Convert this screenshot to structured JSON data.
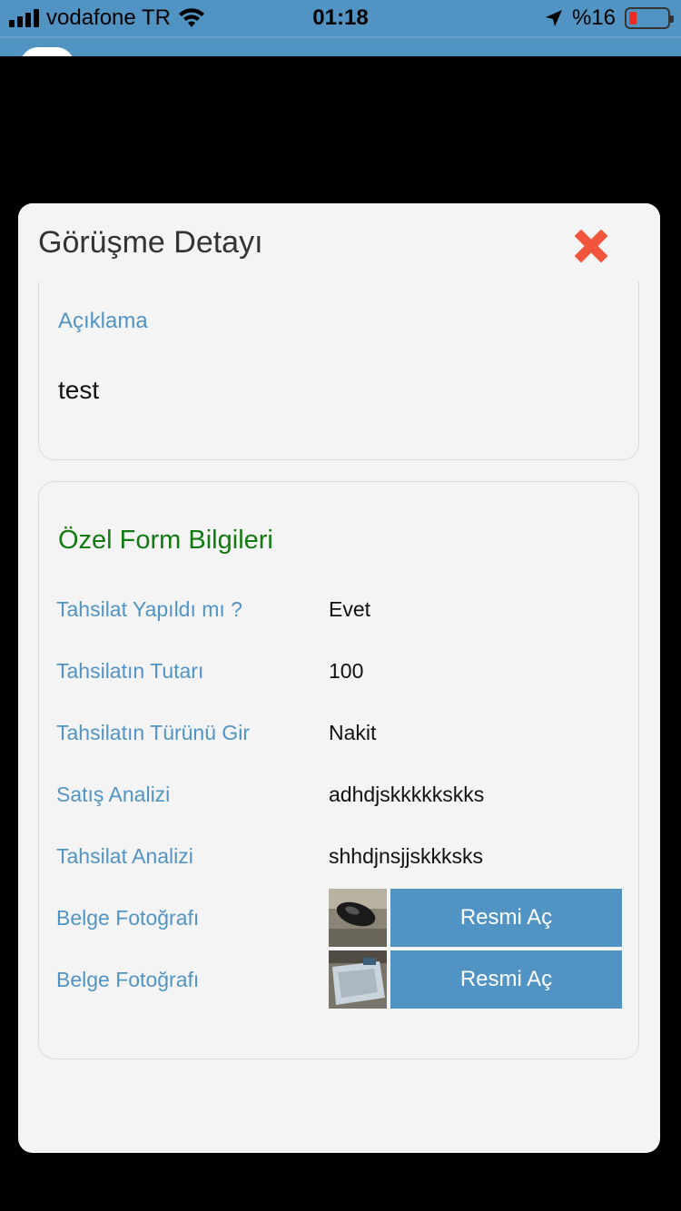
{
  "status_bar": {
    "carrier": "vodafone TR",
    "time": "01:18",
    "battery_percent": "%16",
    "battery_level": 0.16,
    "icons": [
      "signal-icon",
      "wifi-icon",
      "location-arrow-icon",
      "battery-icon"
    ]
  },
  "modal": {
    "title": "Görüşme Detayı",
    "close_icon": "close-x-icon",
    "close_color": "#f2553d"
  },
  "description": {
    "label": "Açıklama",
    "value": "test"
  },
  "custom_form": {
    "title": "Özel Form Bilgileri",
    "fields": [
      {
        "label": "Tahsilat Yapıldı mı ?",
        "value": "Evet"
      },
      {
        "label": "Tahsilatın Tutarı",
        "value": "100"
      },
      {
        "label": "Tahsilatın Türünü Gir",
        "value": "Nakit"
      },
      {
        "label": "Satış Analizi",
        "value": "adhdjskkkkkskks"
      },
      {
        "label": "Tahsilat Analizi",
        "value": "shhdjnsjjskkksks"
      }
    ],
    "photos": [
      {
        "label": "Belge Fotoğrafı",
        "button": "Resmi Aç"
      },
      {
        "label": "Belge Fotoğrafı",
        "button": "Resmi Aç"
      }
    ]
  },
  "colors": {
    "accent": "#5194c4",
    "form_title": "#117a11",
    "modal_bg": "#f4f4f4"
  }
}
